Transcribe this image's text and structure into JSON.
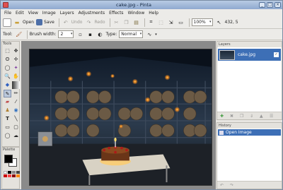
{
  "window": {
    "title": "cake.jpg - Pinta",
    "min_icon": "_",
    "max_icon": "□",
    "close_icon": "×"
  },
  "menu": [
    "File",
    "Edit",
    "View",
    "Image",
    "Layers",
    "Adjustments",
    "Effects",
    "Window",
    "Help"
  ],
  "toolbar": {
    "open_label": "Open",
    "save_label": "Save",
    "undo_label": "Undo",
    "redo_label": "Redo",
    "zoom_value": "100%",
    "cursor_pos": "432, 5"
  },
  "tool_options": {
    "tool_label": "Tool:",
    "brush_width_label": "Brush width:",
    "brush_width_value": "2",
    "type_label": "Type:",
    "type_value": "Normal"
  },
  "panels": {
    "tools_title": "Tools",
    "palette_title": "Palette",
    "layers_title": "Layers",
    "history_title": "History"
  },
  "layers": [
    {
      "name": "cake.jpg",
      "visible": true
    }
  ],
  "history": [
    {
      "name": "Open Image"
    }
  ],
  "colors": {
    "accent": "#3d6fb6",
    "primary": "#000000",
    "secondary": "#ffffff"
  }
}
